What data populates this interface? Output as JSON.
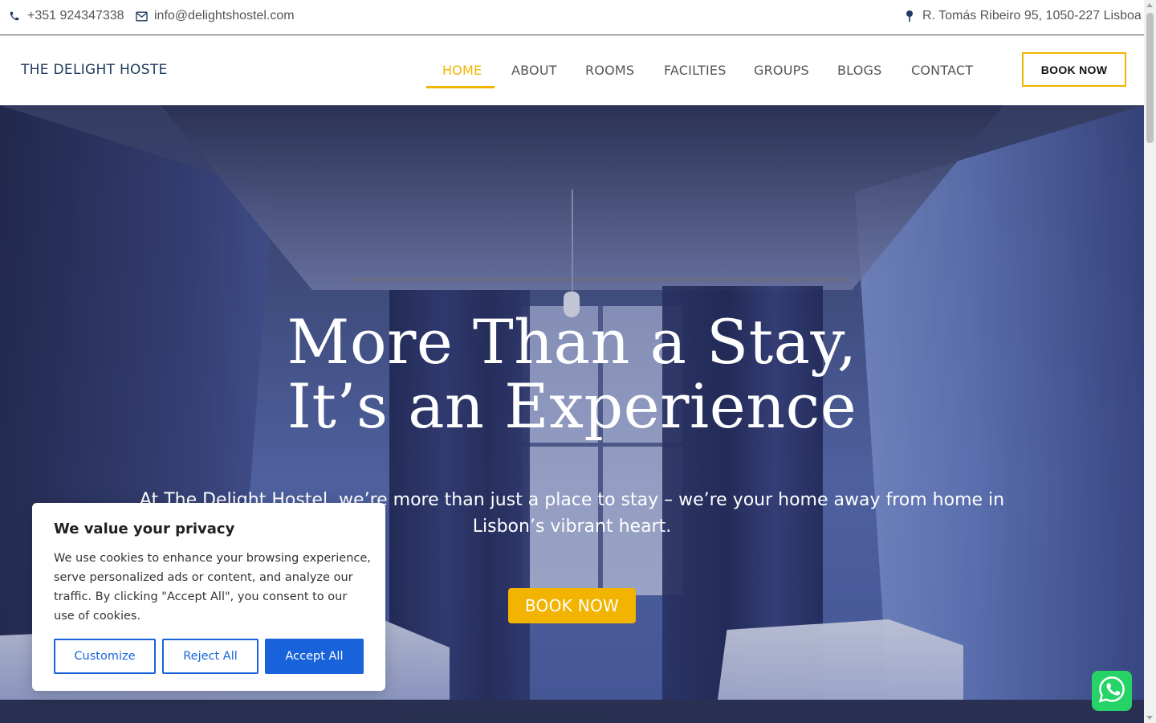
{
  "topbar": {
    "phone": "+351 924347338",
    "email": "info@delightshostel.com",
    "address": "R. Tomás Ribeiro 95, 1050-227 Lisboa",
    "icons": [
      "phone-icon",
      "mail-icon",
      "map-pin-icon"
    ]
  },
  "header": {
    "logo": "THE DELIGHT HOSTE",
    "nav": [
      "HOME",
      "ABOUT",
      "ROOMS",
      "FACILTIES",
      "GROUPS",
      "BLOGS",
      "CONTACT"
    ],
    "active_nav": "HOME",
    "book_button": "BOOK NOW"
  },
  "hero": {
    "title_line1": "More Than a Stay,",
    "title_line2": "It’s an Experience",
    "subtitle": "At The Delight Hostel, we’re more than just a place to stay – we’re your home away from home in Lisbon’s vibrant heart.",
    "button": "BOOK NOW"
  },
  "cookie": {
    "title": "We value your privacy",
    "text": "We use cookies to enhance your browsing experience, serve personalized ads or content, and analyze our traffic. By clicking \"Accept All\", you consent to our use of cookies.",
    "customize": "Customize",
    "reject": "Reject All",
    "accept": "Accept All"
  },
  "colors": {
    "accent": "#f2b400",
    "cookie_blue": "#1863dc",
    "whatsapp": "#25d366"
  }
}
